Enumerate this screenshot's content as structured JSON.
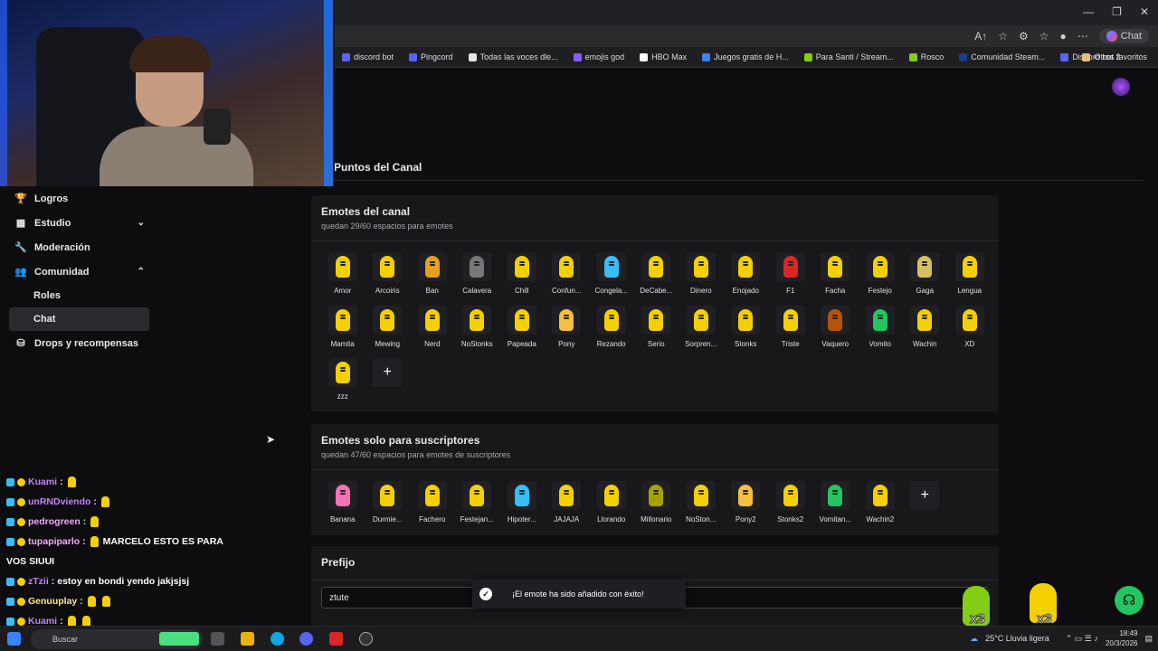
{
  "browser": {
    "addr_icons": [
      "A↑",
      "☆",
      "⚙",
      "☆",
      "●",
      "⋯"
    ],
    "chat_label": "Chat",
    "window_controls": [
      "—",
      "❐",
      "✕"
    ],
    "bookmarks": [
      {
        "label": "discord bot",
        "color": "#5865f2"
      },
      {
        "label": "Pingcord",
        "color": "#5865f2"
      },
      {
        "label": "Todas las voces dle...",
        "color": "#e5e5e5"
      },
      {
        "label": "emojis god",
        "color": "#8b5cf6"
      },
      {
        "label": "HBO Max",
        "color": "#ffffff"
      },
      {
        "label": "Juegos gratis de H...",
        "color": "#3b82f6"
      },
      {
        "label": "Para Santi / Stream...",
        "color": "#84cc16"
      },
      {
        "label": "Rosco",
        "color": "#84cc16"
      },
      {
        "label": "Comunidad Steam...",
        "color": "#1e3a8a"
      },
      {
        "label": "Discord bot 2",
        "color": "#5865f2"
      }
    ],
    "other_favorites": "Otros favoritos"
  },
  "sidebar": {
    "items": [
      {
        "label": "Logros",
        "icon": "trophy-icon",
        "glyph": "🏆"
      },
      {
        "label": "Estudio",
        "icon": "studio-icon",
        "glyph": "▦",
        "chevron": "⌄"
      },
      {
        "label": "Moderación",
        "icon": "wrench-icon",
        "glyph": "🔧"
      },
      {
        "label": "Comunidad",
        "icon": "community-icon",
        "glyph": "👥",
        "chevron": "⌃"
      }
    ],
    "sub_items": [
      "Roles",
      "Chat"
    ],
    "drops": {
      "label": "Drops y recompensas",
      "icon": "gift-icon",
      "glyph": "⛁"
    }
  },
  "page": {
    "heading": "Puntos del Canal"
  },
  "channel_emotes": {
    "title": "Emotes del canal",
    "subtitle": "quedan 29/60 espacios para emotes",
    "emotes": [
      "Amor",
      "Arcoiris",
      "Ban",
      "Calavera",
      "Chill",
      "Confun...",
      "Congela...",
      "DeCabe...",
      "Dinero",
      "Enojado",
      "F1",
      "Facha",
      "Festejo",
      "Gaga",
      "Lengua",
      "Mamita",
      "Mewing",
      "Nerd",
      "NoStonks",
      "Papeada",
      "Pony",
      "Rezando",
      "Serio",
      "Sorpren...",
      "Stonks",
      "Triste",
      "Vaquero",
      "Vomito",
      "Wachin",
      "XD",
      "zzz"
    ],
    "colors": [
      "#f5d000",
      "#f5d000",
      "#e5a020",
      "#777777",
      "#f5d000",
      "#f5d000",
      "#38bdf8",
      "#f5d000",
      "#f5d000",
      "#f5d000",
      "#dc2626",
      "#f5d000",
      "#f5d000",
      "#d4c060",
      "#f5d000",
      "#f5d000",
      "#f5d000",
      "#f5d000",
      "#f5d000",
      "#f5d000",
      "#f5c040",
      "#f5d000",
      "#f5d000",
      "#f5d000",
      "#f5d000",
      "#f5d000",
      "#b45309",
      "#22c55e",
      "#f5d000",
      "#f5d000",
      "#f5d000"
    ],
    "add_label": "+"
  },
  "sub_emotes": {
    "title": "Emotes solo para suscriptores",
    "subtitle": "quedan 47/60 espacios para emotes de suscriptores",
    "emotes": [
      "Banana",
      "Durmie...",
      "Fachero",
      "Festejan...",
      "Hipoter...",
      "JAJAJA",
      "Llorando",
      "Millonario",
      "NoSton...",
      "Pony2",
      "Stonks2",
      "Vomitan...",
      "Wachin2"
    ],
    "colors": [
      "#f472b6",
      "#f5d000",
      "#f5d000",
      "#f5d000",
      "#38bdf8",
      "#f5d000",
      "#f5d000",
      "#a3a300",
      "#f5d000",
      "#f5c040",
      "#f5d000",
      "#22c55e",
      "#f5d000"
    ],
    "add_label": "+"
  },
  "prefix": {
    "title": "Prefijo",
    "value": "ztute"
  },
  "toast": {
    "check": "✓",
    "message": "¡El emote ha sido añadido con éxito!"
  },
  "overlay": {
    "multiplier_1": "x3",
    "multiplier_2": "x3"
  },
  "chat_overlay": [
    {
      "user": "Kuami",
      "color": "#c084fc",
      "text": "",
      "bananas": 1
    },
    {
      "user": "unRNDviendo",
      "color": "#c084fc",
      "text": "",
      "bananas": 1
    },
    {
      "user": "pedrogreen",
      "color": "#f0abfc",
      "text": "",
      "bananas": 1
    },
    {
      "user": "tupapiparlo",
      "color": "#f0abfc",
      "text": "MARCELO ESTO ES PARA",
      "bananas": 1
    },
    {
      "user": "",
      "color": "#ffffff",
      "text": "VOS SIUUI",
      "bananas": 0
    },
    {
      "user": "zTzii",
      "color": "#c084fc",
      "text": "estoy en bondi yendo jakjsjsj",
      "bananas": 0
    },
    {
      "user": "Genuuplay",
      "color": "#fde68a",
      "text": "",
      "bananas": 2
    },
    {
      "user": "Kuami",
      "color": "#c084fc",
      "text": "",
      "bananas": 2
    }
  ],
  "taskbar": {
    "search": "Buscar",
    "weather": "25°C  Lluvia ligera",
    "time": "18:49",
    "date": "20/3/2026"
  }
}
